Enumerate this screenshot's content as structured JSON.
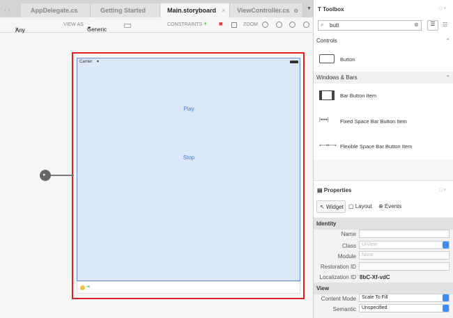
{
  "tabs": [
    {
      "label": "AppDelegate.cs"
    },
    {
      "label": "Getting Started"
    },
    {
      "label": "Main.storyboard",
      "active": true
    },
    {
      "label": "ViewController.cs"
    }
  ],
  "toolbar": {
    "size_class_w": "w",
    "size_class_w_val": "Any",
    "size_class_h": "h",
    "size_class_h_val": "Any",
    "view_as_label": "VIEW AS",
    "view_as_value": "Generic",
    "constraints_label": "CONSTRAINTS",
    "zoom_label": "ZOOM"
  },
  "canvas": {
    "carrier": "Carrier",
    "play": "Play",
    "stop": "Stop"
  },
  "toolbox": {
    "title": "Toolbox",
    "search_value": "butt",
    "sections": [
      {
        "title": "Controls",
        "items": [
          "Button"
        ]
      },
      {
        "title": "Windows & Bars",
        "items": [
          "Bar Button Item",
          "Fixed Space Bar Button Item",
          "Flexible Space Bar Button Item"
        ]
      }
    ]
  },
  "properties": {
    "title": "Properties",
    "tabs": [
      "Widget",
      "Layout",
      "Events"
    ],
    "identity_header": "Identity",
    "name_label": "Name",
    "name_value": "",
    "class_label": "Class",
    "class_placeholder": "UIView",
    "module_label": "Module",
    "module_placeholder": "None",
    "restoration_label": "Restoration ID",
    "localization_label": "Localization ID",
    "localization_value": "8bC-Xf-vdC",
    "view_header": "View",
    "content_mode_label": "Content Mode",
    "content_mode_value": "Scale To Fill",
    "semantic_label": "Semantic",
    "semantic_value": "Unspecified"
  },
  "colors": {
    "selection": "#e02020",
    "accent": "#2f7fe0",
    "device_bg": "#dce8f8"
  }
}
